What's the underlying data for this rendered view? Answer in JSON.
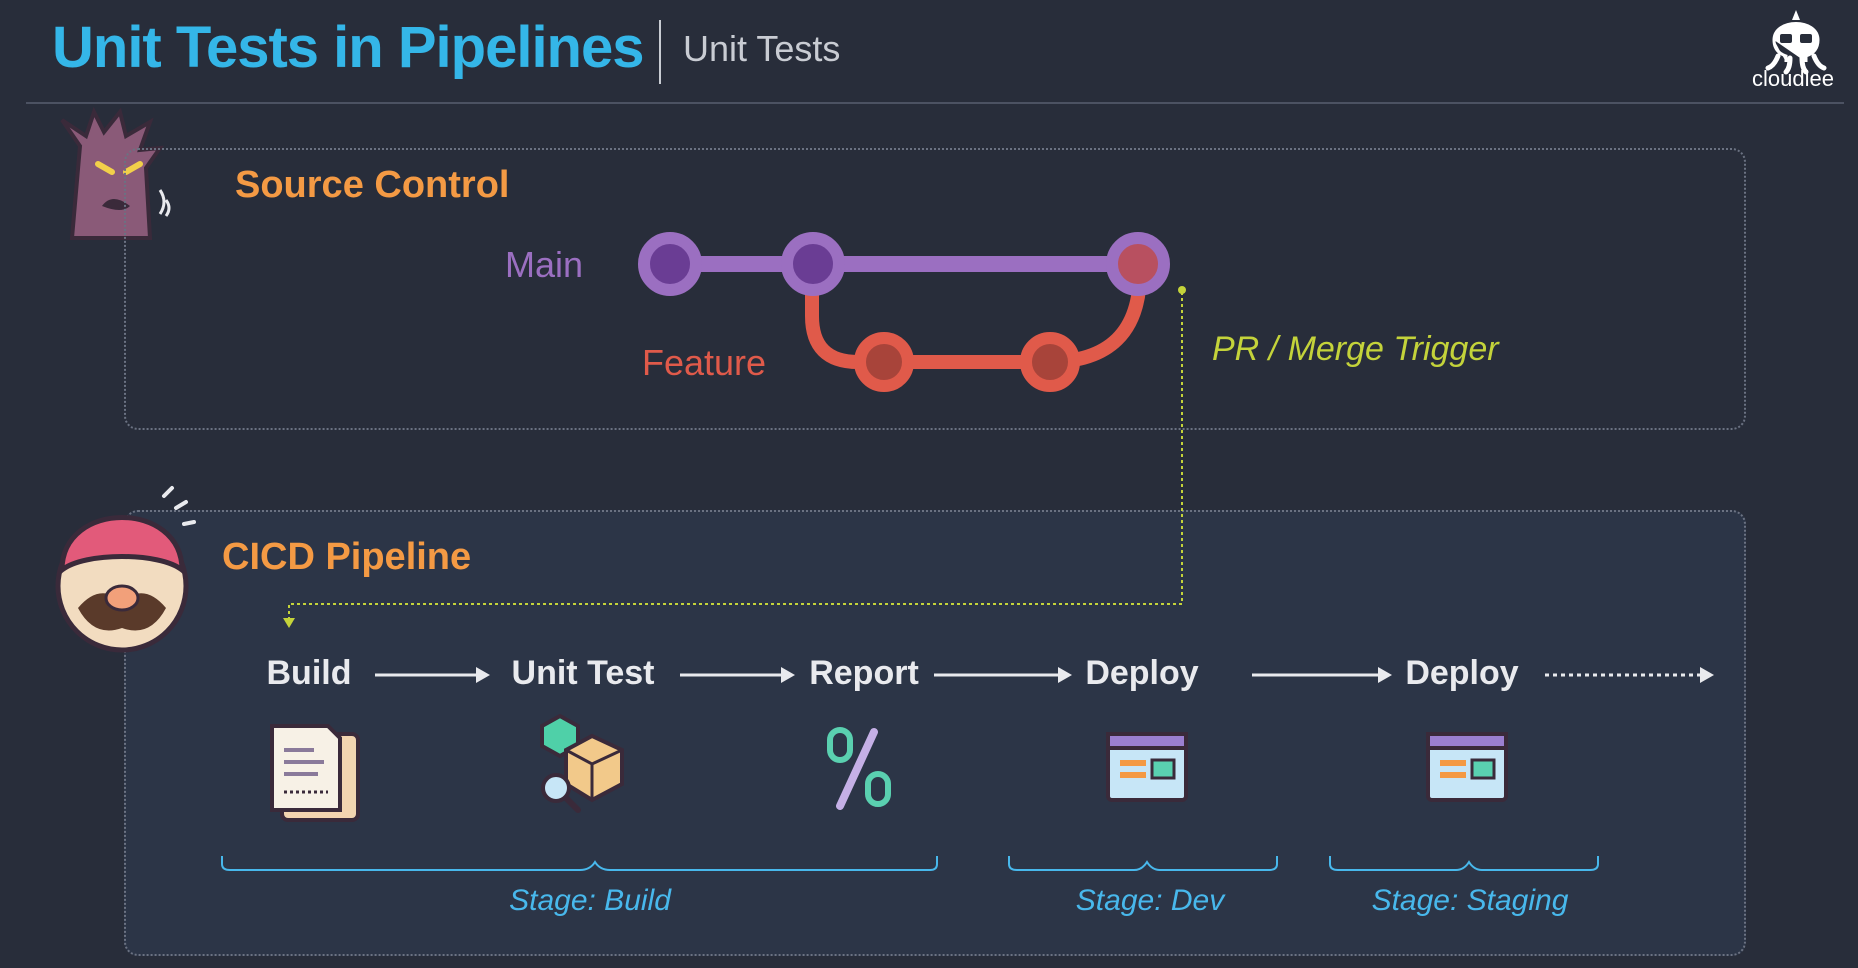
{
  "header": {
    "title": "Unit Tests in Pipelines",
    "subtitle": "Unit Tests",
    "brand": "cloudlee"
  },
  "source_control": {
    "title": "Source Control",
    "branches": {
      "main": "Main",
      "feature": "Feature"
    },
    "trigger_label": "PR / Merge Trigger"
  },
  "pipeline": {
    "title": "CICD Pipeline",
    "stages": [
      {
        "label": "Build",
        "icon": "document-icon"
      },
      {
        "label": "Unit Test",
        "icon": "package-test-icon"
      },
      {
        "label": "Report",
        "icon": "percent-icon"
      },
      {
        "label": "Deploy",
        "icon": "browser-window-icon"
      },
      {
        "label": "Deploy",
        "icon": "browser-window-icon"
      }
    ],
    "stage_groups": [
      {
        "label": "Stage: Build"
      },
      {
        "label": "Stage: Dev"
      },
      {
        "label": "Stage: Staging"
      }
    ]
  },
  "colors": {
    "title": "#34b6e8",
    "section_title": "#f49a44",
    "main_branch": "#9b6fc1",
    "feature_branch": "#e05a4a",
    "trigger": "#c4d33a",
    "stage_group": "#48b8ec"
  }
}
